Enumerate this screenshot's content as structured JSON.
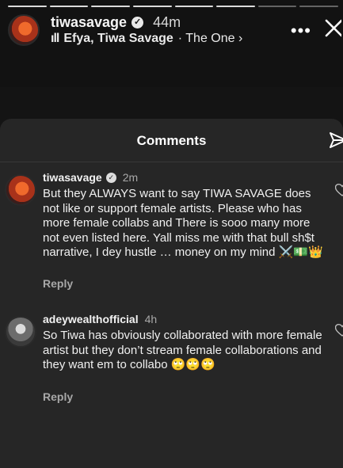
{
  "story": {
    "username": "tiwasavage",
    "time": "44m",
    "music_bars": "ıll",
    "music_artist": "Efya, Tiwa Savage",
    "music_song": "· The One ›",
    "more_label": "•••"
  },
  "comments_sheet": {
    "title": "Comments",
    "comments": [
      {
        "username": "tiwasavage",
        "time": "2m",
        "text": "But they ALWAYS want to say TIWA SAVAGE does not like or support female artists. Please who has more female collabs and There is sooo many more not even listed here. Yall miss me with that bull sh$t narrative, I dey hustle … money on my mind ⚔️💵👑",
        "reply_label": "Reply"
      },
      {
        "username": "adeywealthofficial",
        "time": "4h",
        "text": "So Tiwa has obviously collaborated with more female artist but they don’t stream female collaborations and they want em to collabo 🙄🙄🙄",
        "reply_label": "Reply"
      }
    ]
  }
}
